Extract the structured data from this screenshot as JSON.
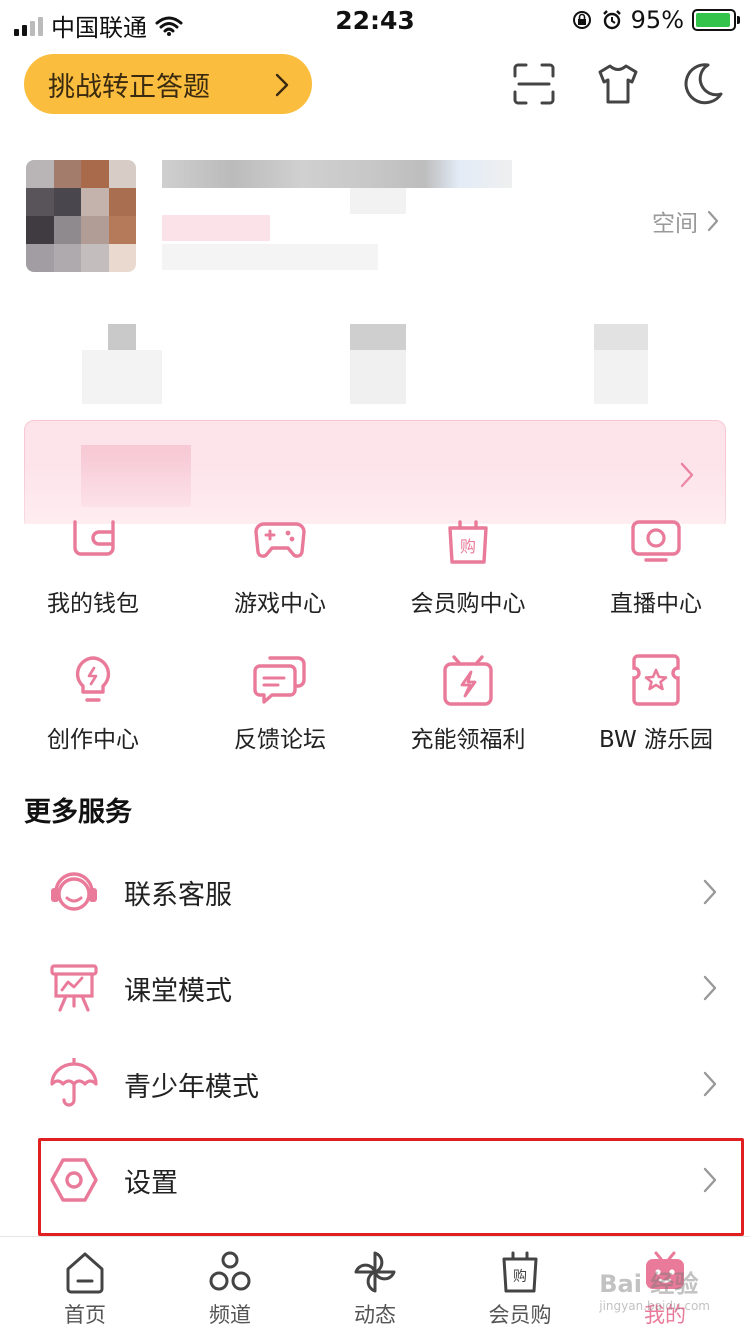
{
  "status_bar": {
    "carrier": "中国联通",
    "time": "22:43",
    "battery_percent": "95%",
    "battery_level": 0.95
  },
  "header": {
    "challenge_label": "挑战转正答题",
    "icons": [
      "scan-icon",
      "tshirt-icon",
      "moon-icon"
    ]
  },
  "profile": {
    "space_label": "空间"
  },
  "services": [
    {
      "label": "我的钱包",
      "icon": "wallet-icon"
    },
    {
      "label": "游戏中心",
      "icon": "gamepad-icon"
    },
    {
      "label": "会员购中心",
      "icon": "shopping-bag-icon"
    },
    {
      "label": "直播中心",
      "icon": "tv-icon"
    },
    {
      "label": "创作中心",
      "icon": "lightbulb-icon"
    },
    {
      "label": "反馈论坛",
      "icon": "chat-bubbles-icon"
    },
    {
      "label": "充能领福利",
      "icon": "gift-lightning-icon"
    },
    {
      "label": "BW 游乐园",
      "icon": "star-ticket-icon"
    }
  ],
  "more_services": {
    "title": "更多服务",
    "items": [
      {
        "label": "联系客服",
        "icon": "headset-icon"
      },
      {
        "label": "课堂模式",
        "icon": "presentation-board-icon"
      },
      {
        "label": "青少年模式",
        "icon": "umbrella-icon"
      },
      {
        "label": "设置",
        "icon": "hexagon-settings-icon"
      }
    ]
  },
  "tab_bar": {
    "tabs": [
      {
        "label": "首页",
        "icon": "home-icon"
      },
      {
        "label": "频道",
        "icon": "channel-circles-icon"
      },
      {
        "label": "动态",
        "icon": "pinwheel-icon"
      },
      {
        "label": "会员购",
        "icon": "shopping-bag-icon"
      },
      {
        "label": "我的",
        "icon": "tv-mascot-icon"
      }
    ],
    "active_index": 4
  },
  "colors": {
    "accent_pink": "#e97a99",
    "challenge_yellow": "#fbbd3e",
    "highlight_red": "#e02020",
    "banner_pink": "#fde3ea"
  },
  "watermark": {
    "text": "Bai 经验",
    "sub": "jingyan.baidu.com"
  }
}
